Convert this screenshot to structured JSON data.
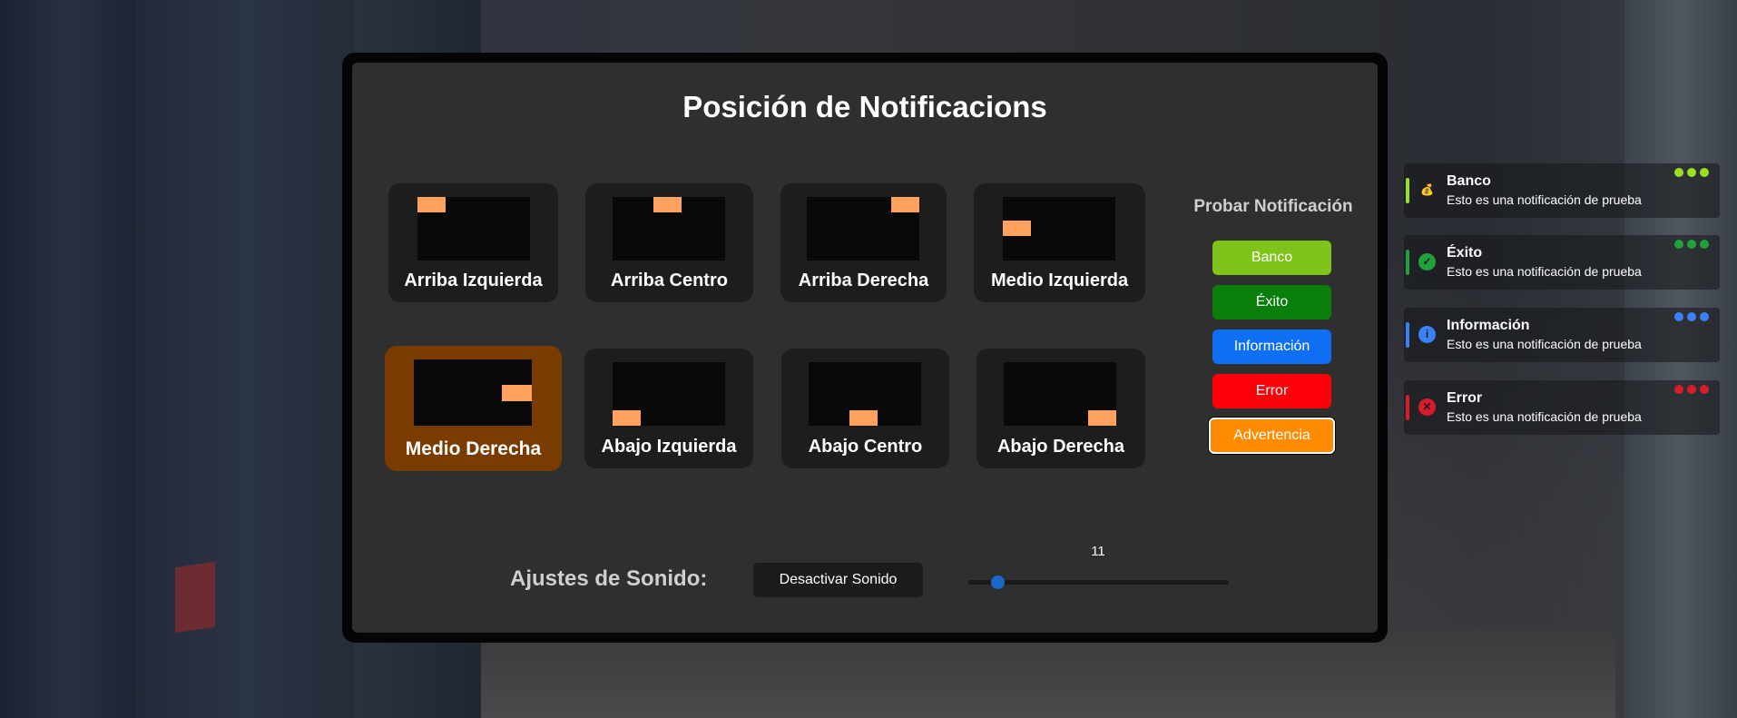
{
  "modal": {
    "title": "Posición de Notificacions",
    "selected_position": "Medio Derecha",
    "positions": [
      {
        "label": "Arriba Izquierda"
      },
      {
        "label": "Arriba Centro"
      },
      {
        "label": "Arriba Derecha"
      },
      {
        "label": "Medio Izquierda"
      },
      {
        "label": "Medio Derecha"
      },
      {
        "label": "Abajo Izquierda"
      },
      {
        "label": "Abajo Centro"
      },
      {
        "label": "Abajo Derecha"
      }
    ],
    "test": {
      "title": "Probar Notificación",
      "buttons": [
        {
          "label": "Banco",
          "color": "#7fc41a"
        },
        {
          "label": "Éxito",
          "color": "#0a7e0a"
        },
        {
          "label": "Información",
          "color": "#0f6ff2"
        },
        {
          "label": "Error",
          "color": "#ff0008"
        },
        {
          "label": "Advertencia",
          "color": "#ff8c00"
        }
      ]
    },
    "sound": {
      "label": "Ajustes de Sonido:",
      "mute_label": "Desactivar Sonido",
      "volume": "11",
      "volume_fraction": 0.11
    }
  },
  "notifications": [
    {
      "title": "Banco",
      "message": "Esto es una notificación de prueba",
      "color": "#9be01f",
      "icon": "money-bag-icon"
    },
    {
      "title": "Éxito",
      "message": "Esto es una notificación de prueba",
      "color": "#1fa23a",
      "icon": "check-circle-icon"
    },
    {
      "title": "Información",
      "message": "Esto es una notificación de prueba",
      "color": "#3b82f6",
      "icon": "info-circle-icon"
    },
    {
      "title": "Error",
      "message": "Esto es una notificación de prueba",
      "color": "#d91c2b",
      "icon": "close-circle-icon"
    }
  ]
}
